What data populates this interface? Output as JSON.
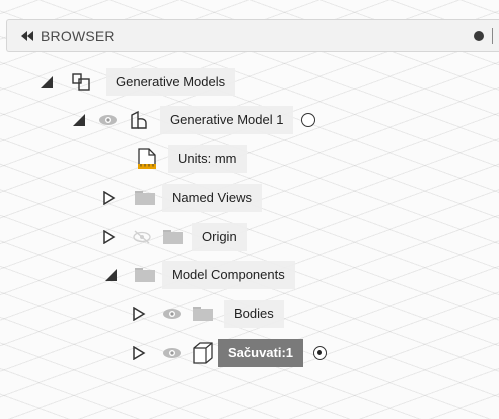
{
  "browser": {
    "title": "BROWSER",
    "icons": {
      "collapse": "double-left-arrow",
      "pin": "filled-circle",
      "divider": "vertical-bar"
    }
  },
  "tree": {
    "generative_models": {
      "label": "Generative Models",
      "expanded": true
    },
    "generative_model_1": {
      "label": "Generative Model 1",
      "expanded": true,
      "active": false
    },
    "units": {
      "label": "Units: mm"
    },
    "named_views": {
      "label": "Named Views",
      "expanded": false
    },
    "origin": {
      "label": "Origin",
      "expanded": false,
      "visible": false
    },
    "model_components": {
      "label": "Model Components",
      "expanded": true
    },
    "bodies": {
      "label": "Bodies",
      "expanded": false,
      "visible": true
    },
    "component": {
      "label": "Sačuvati:1",
      "expanded": false,
      "visible": true,
      "active": true,
      "selected": true
    }
  },
  "colors": {
    "selected_bg": "#7a7a7a",
    "header_bg": "#f2f2f2",
    "units_accent": "#e8a000"
  }
}
